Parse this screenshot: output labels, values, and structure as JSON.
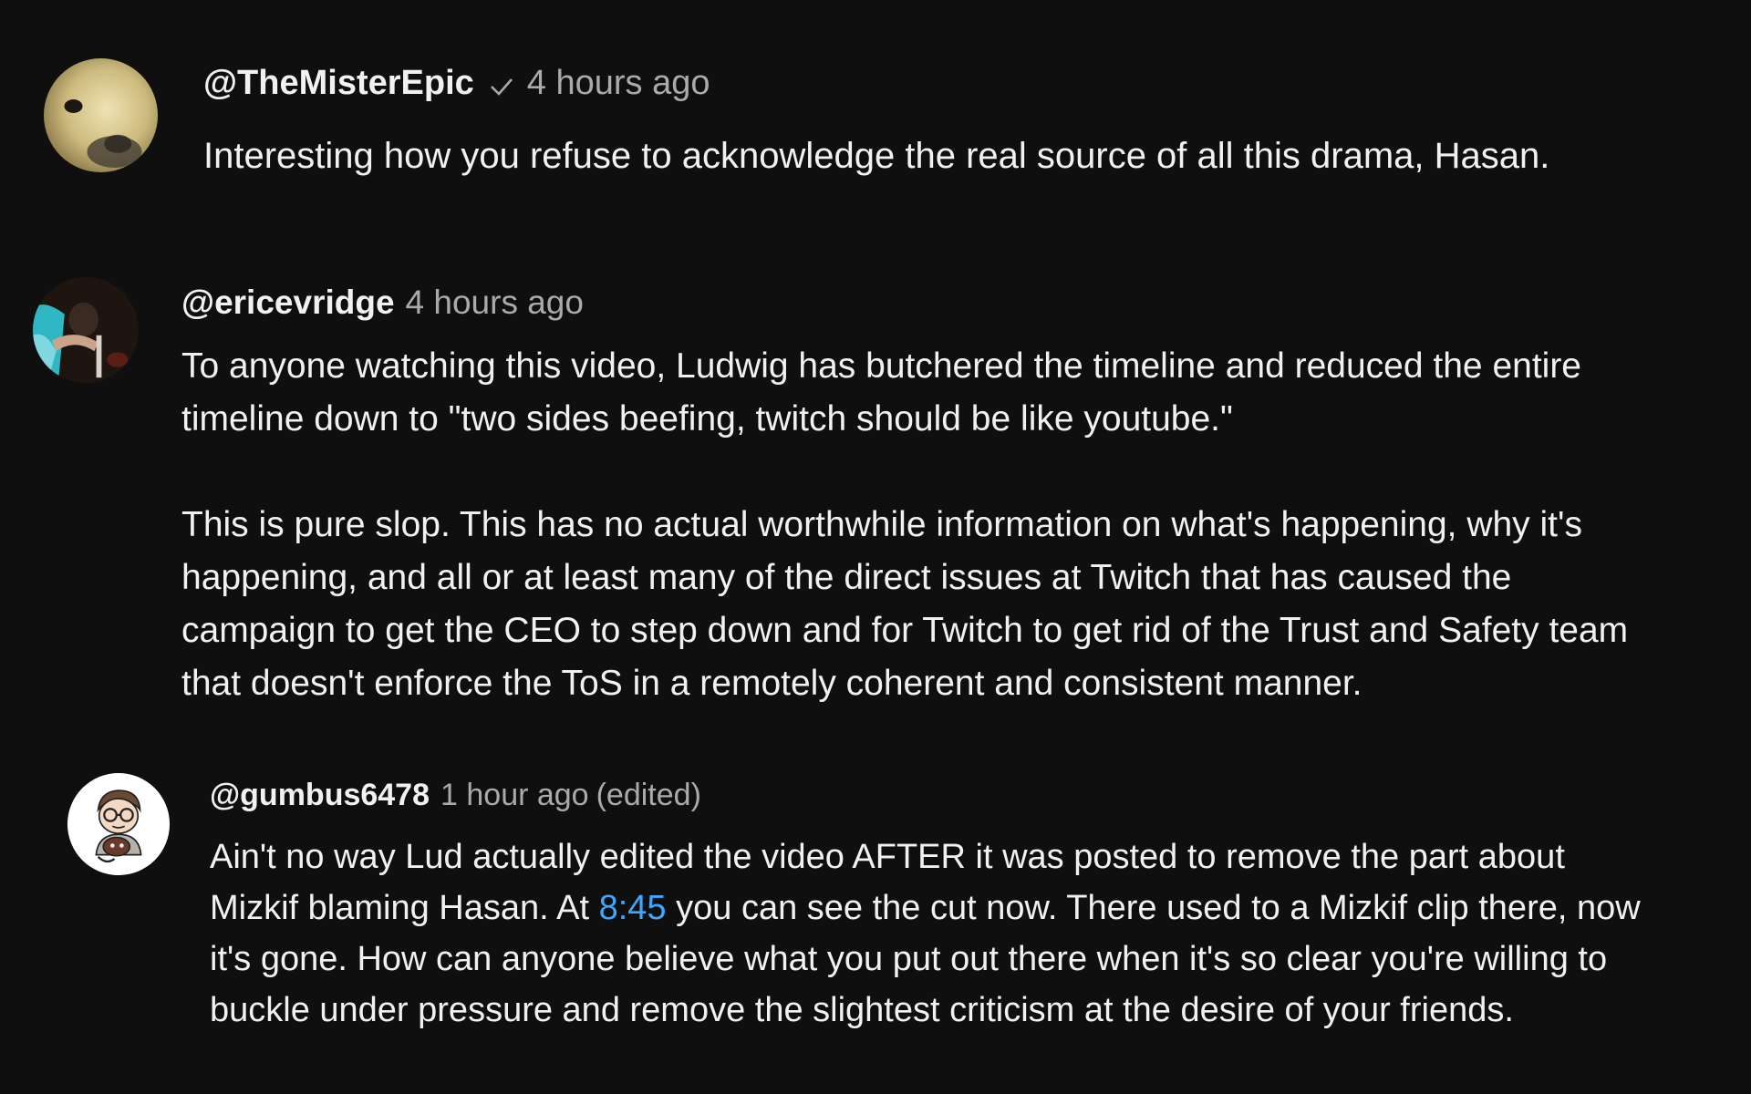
{
  "comments": [
    {
      "author": "@TheMisterEpic",
      "verified": true,
      "time": "4 hours ago",
      "text": "Interesting how you refuse to acknowledge the real source of all this drama, Hasan."
    },
    {
      "author": "@ericevridge",
      "time": "4 hours ago",
      "paragraph1_line1": "To anyone watching this video, Ludwig has butchered the timeline and reduced the entire",
      "paragraph1_line2": "timeline down to \"two sides beefing, twitch should be like youtube.\"",
      "paragraph2_line1": "This is pure slop. This has no actual worthwhile information on what's happening, why it's",
      "paragraph2_line2": "happening, and all or at least many of the direct issues at Twitch that has caused the",
      "paragraph2_line3": "campaign to get the CEO to step down and for Twitch to get rid of the Trust and Safety team",
      "paragraph2_line4": "that doesn't enforce the ToS in a remotely coherent and consistent manner."
    },
    {
      "author": "@gumbus6478",
      "time": "1 hour ago",
      "edited": "(edited)",
      "line1": "Ain't no way Lud actually edited the video AFTER it was posted to remove the part about",
      "line2_before": "Mizkif blaming Hasan. At ",
      "timestamp_link": "8:45",
      "line2_after": " you can see the cut now. There used to a Mizkif clip there, now",
      "line3": "it's gone. How can anyone believe what you put out there when it's so clear you're willing to",
      "line4": "buckle under pressure and remove the slightest criticism at the desire of your friends."
    }
  ],
  "colors": {
    "background": "#0f0f0f",
    "text": "#f1f1f1",
    "secondary_text": "#aaaaaa",
    "link": "#3ea6ff"
  }
}
